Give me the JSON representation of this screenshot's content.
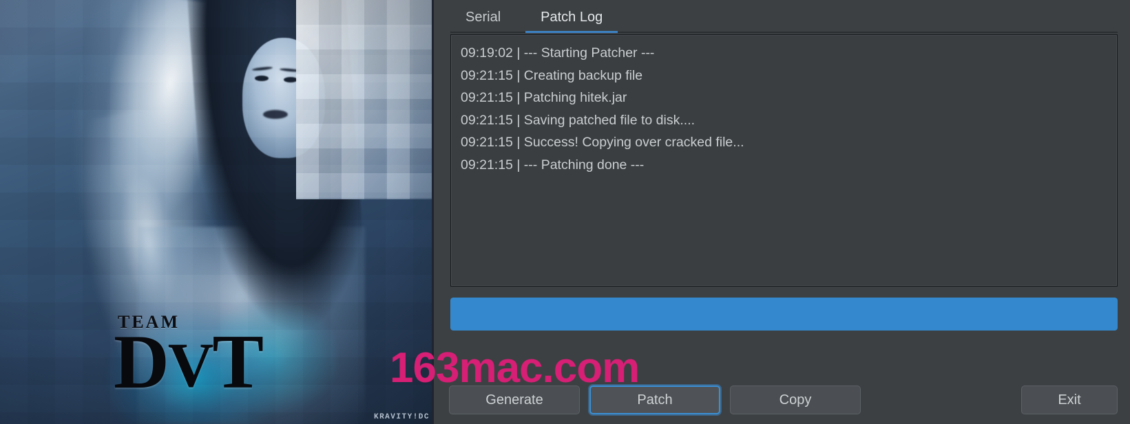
{
  "artwork": {
    "logo_team": "TEAM",
    "logo_name_left": "D",
    "logo_name_mid": "V",
    "logo_name_right": "T",
    "credit": "KRAVITY!DC",
    "description": "blue-toned angel woman artwork with pixel mosaic"
  },
  "watermark": {
    "text": "163mac.com",
    "color": "#d61f75"
  },
  "tabs": [
    {
      "label": "Serial",
      "active": false
    },
    {
      "label": "Patch Log",
      "active": true
    }
  ],
  "log": {
    "lines": [
      "09:19:02 | --- Starting Patcher ---",
      "09:21:15 | Creating backup file",
      "09:21:15 | Patching hitek.jar",
      "09:21:15 | Saving patched file to disk....",
      "09:21:15 | Success! Copying over cracked file...",
      "09:21:15 | --- Patching done ---"
    ]
  },
  "progress": {
    "percent": 100,
    "fill_color": "#3489ce",
    "track_color": "#34383b"
  },
  "buttons": {
    "generate": "Generate",
    "patch": "Patch",
    "copy": "Copy",
    "exit": "Exit"
  },
  "colors": {
    "panel_bg": "#3c4043",
    "log_bg": "#3a3e41",
    "accent": "#3d82c4",
    "text": "#cbced0"
  }
}
